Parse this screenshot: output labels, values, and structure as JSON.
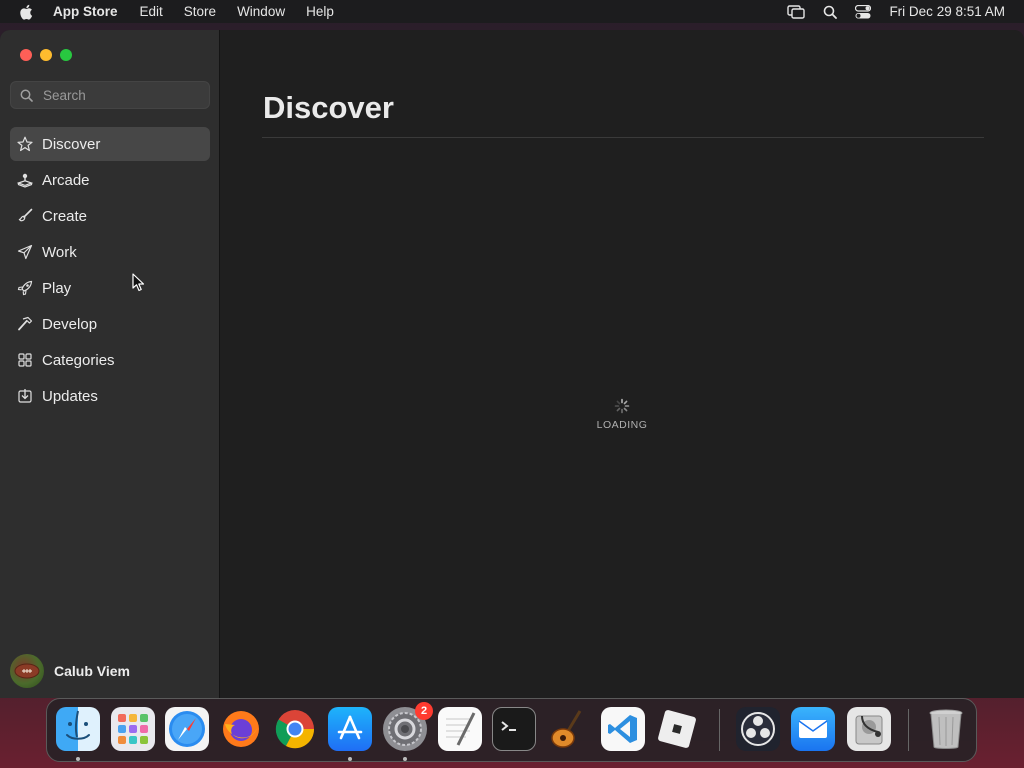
{
  "menubar": {
    "app_name": "App Store",
    "menus": [
      "Edit",
      "Store",
      "Window",
      "Help"
    ],
    "clock": "Fri Dec 29  8:51 AM",
    "status_icons": [
      "screen-mirroring-icon",
      "spotlight-search-icon",
      "control-center-icon"
    ]
  },
  "sidebar": {
    "search": {
      "placeholder": "Search",
      "value": ""
    },
    "items": [
      {
        "label": "Discover",
        "icon": "star-icon",
        "active": true
      },
      {
        "label": "Arcade",
        "icon": "joystick-icon",
        "active": false
      },
      {
        "label": "Create",
        "icon": "brush-icon",
        "active": false
      },
      {
        "label": "Work",
        "icon": "paper-plane-icon",
        "active": false
      },
      {
        "label": "Play",
        "icon": "rocket-icon",
        "active": false
      },
      {
        "label": "Develop",
        "icon": "hammer-icon",
        "active": false
      },
      {
        "label": "Categories",
        "icon": "grid-icon",
        "active": false
      },
      {
        "label": "Updates",
        "icon": "download-icon",
        "active": false
      }
    ],
    "user": {
      "name": "Calub Viem"
    }
  },
  "main": {
    "title": "Discover",
    "loading_text": "LOADING"
  },
  "dock": {
    "apps": [
      {
        "name": "finder-icon",
        "running": true
      },
      {
        "name": "launchpad-icon",
        "running": false
      },
      {
        "name": "safari-icon",
        "running": false
      },
      {
        "name": "firefox-icon",
        "running": false
      },
      {
        "name": "chrome-icon",
        "running": false
      },
      {
        "name": "app-store-icon",
        "running": true
      },
      {
        "name": "system-settings-icon",
        "running": true,
        "badge": "2"
      },
      {
        "name": "textedit-icon",
        "running": false
      },
      {
        "name": "terminal-icon",
        "running": false
      },
      {
        "name": "garageband-icon",
        "running": false
      },
      {
        "name": "vscode-icon",
        "running": false
      },
      {
        "name": "roblox-icon",
        "running": false
      },
      {
        "name": "obs-icon",
        "running": false
      },
      {
        "name": "mail-icon",
        "running": false
      },
      {
        "name": "disk-utility-icon",
        "running": false
      },
      {
        "name": "trash-icon",
        "running": false
      }
    ]
  },
  "colors": {
    "sidebar_bg": "#2e2e2e",
    "main_bg": "#1f1f1f",
    "active_item_bg": "#474747",
    "badge": "#ff3b30"
  }
}
